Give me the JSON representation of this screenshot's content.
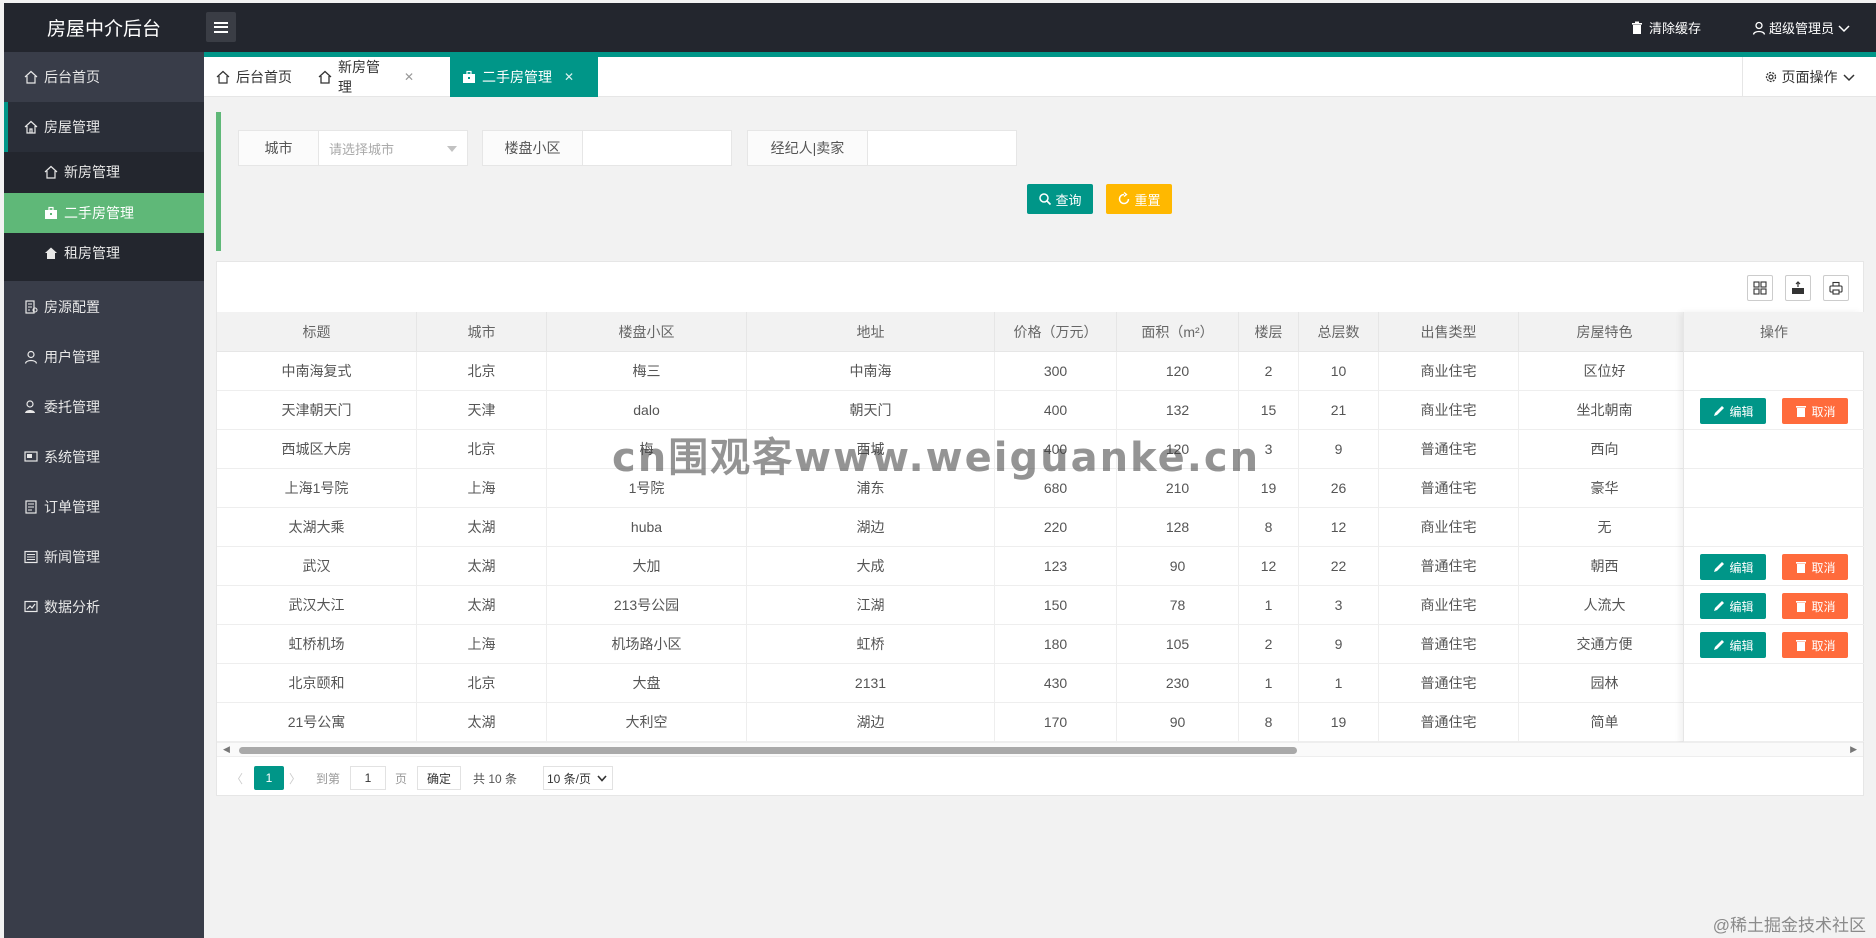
{
  "header": {
    "logo": "房屋中介后台",
    "clear_cache": "清除缓存",
    "user": "超级管理员"
  },
  "sidebar": {
    "items": [
      {
        "label": "后台首页",
        "icon": "home-icon"
      },
      {
        "label": "房屋管理",
        "icon": "house-icon"
      },
      {
        "label": "房源配置",
        "icon": "config-icon"
      },
      {
        "label": "用户管理",
        "icon": "user-icon"
      },
      {
        "label": "委托管理",
        "icon": "entrust-icon"
      },
      {
        "label": "系统管理",
        "icon": "system-icon"
      },
      {
        "label": "订单管理",
        "icon": "order-icon"
      },
      {
        "label": "新闻管理",
        "icon": "news-icon"
      },
      {
        "label": "数据分析",
        "icon": "chart-icon"
      }
    ],
    "sub_items": [
      {
        "label": "新房管理",
        "icon": "house-icon"
      },
      {
        "label": "二手房管理",
        "icon": "briefcase-icon"
      },
      {
        "label": "租房管理",
        "icon": "rent-icon"
      }
    ]
  },
  "tabs": [
    {
      "label": "后台首页"
    },
    {
      "label": "新房管理"
    },
    {
      "label": "二手房管理"
    }
  ],
  "page_ops": "页面操作",
  "search": {
    "city_label": "城市",
    "city_placeholder": "请选择城市",
    "community_label": "楼盘小区",
    "agent_label": "经纪人|卖家",
    "query": "查询",
    "reset": "重置"
  },
  "table": {
    "columns": [
      "标题",
      "城市",
      "楼盘小区",
      "地址",
      "价格（万元）",
      "面积（m²）",
      "楼层",
      "总层数",
      "出售类型",
      "房屋特色"
    ],
    "ops_header": "操作",
    "rows": [
      [
        "中南海复式",
        "北京",
        "梅三",
        "中南海",
        "300",
        "120",
        "2",
        "10",
        "商业住宅",
        "区位好"
      ],
      [
        "天津朝天门",
        "天津",
        "dalo",
        "朝天门",
        "400",
        "132",
        "15",
        "21",
        "商业住宅",
        "坐北朝南"
      ],
      [
        "西城区大房",
        "北京",
        "梅",
        "西城",
        "400",
        "120",
        "3",
        "9",
        "普通住宅",
        "西向"
      ],
      [
        "上海1号院",
        "上海",
        "1号院",
        "浦东",
        "680",
        "210",
        "19",
        "26",
        "普通住宅",
        "豪华"
      ],
      [
        "太湖大乘",
        "太湖",
        "huba",
        "湖边",
        "220",
        "128",
        "8",
        "12",
        "商业住宅",
        "无"
      ],
      [
        "武汉",
        "太湖",
        "大加",
        "大成",
        "123",
        "90",
        "12",
        "22",
        "普通住宅",
        "朝西"
      ],
      [
        "武汉大江",
        "太湖",
        "213号公园",
        "江湖",
        "150",
        "78",
        "1",
        "3",
        "商业住宅",
        "人流大"
      ],
      [
        "虹桥机场",
        "上海",
        "机场路小区",
        "虹桥",
        "180",
        "105",
        "2",
        "9",
        "普通住宅",
        "交通方便"
      ],
      [
        "北京颐和",
        "北京",
        "大盘",
        "2131",
        "430",
        "230",
        "1",
        "1",
        "普通住宅",
        "园林"
      ],
      [
        "21号公寓",
        "太湖",
        "大利空",
        "湖边",
        "170",
        "90",
        "8",
        "19",
        "普通住宅",
        "简单"
      ]
    ],
    "ops": [
      false,
      true,
      false,
      false,
      false,
      true,
      true,
      true,
      false,
      false
    ],
    "edit_label": "编辑",
    "cancel_label": "取消"
  },
  "pager": {
    "current": "1",
    "goto_label": "到第",
    "goto_value": "1",
    "page_unit": "页",
    "confirm": "确定",
    "total": "共 10 条",
    "per_page": "10 条/页"
  },
  "watermark": "cn围观客www.weiguanke.cn",
  "corner_mark": "@稀土掘金技术社区",
  "colors": {
    "accent": "#009688",
    "active_green": "#5fb878",
    "reset_yellow": "#ffb800",
    "cancel_orange": "#ff5722",
    "sidebar_bg": "#393d49",
    "header_bg": "#23262e"
  }
}
